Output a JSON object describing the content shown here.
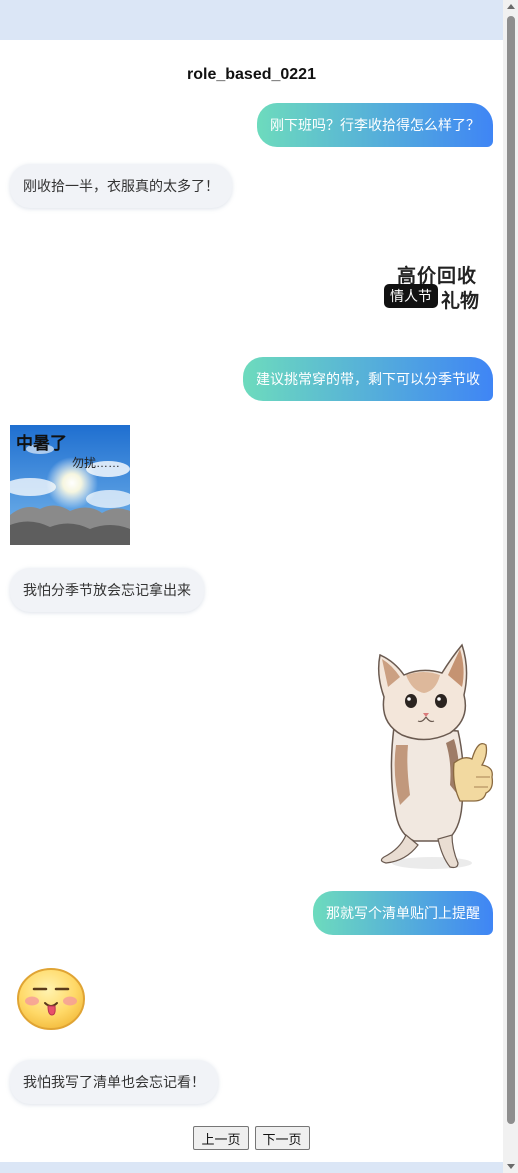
{
  "chat": {
    "title": "role_based_0221",
    "messages": [
      {
        "side": "right",
        "type": "text",
        "text": "刚下班吗？行李收拾得怎么样了？"
      },
      {
        "side": "left",
        "type": "text",
        "text": "刚收拾一半，衣服真的太多了！"
      },
      {
        "side": "right",
        "type": "sticker",
        "sticker": "text-sticker-gift-recycle",
        "lines": [
          "高价回收",
          "情人节",
          "礼物"
        ]
      },
      {
        "side": "right",
        "type": "text",
        "text": "建议挑常穿的带，剩下可以分季节收"
      },
      {
        "side": "left",
        "type": "sticker",
        "sticker": "heatstroke-sky-meme",
        "lines": [
          "中暑了",
          "勿扰……"
        ]
      },
      {
        "side": "left",
        "type": "text",
        "text": "我怕分季节放会忘记拿出来"
      },
      {
        "side": "right",
        "type": "sticker",
        "sticker": "kitten-thumbs-up"
      },
      {
        "side": "right",
        "type": "text",
        "text": "那就写个清单贴门上提醒"
      },
      {
        "side": "left",
        "type": "sticker",
        "sticker": "yellow-face-tongue-emoji"
      },
      {
        "side": "left",
        "type": "text",
        "text": "我怕我写了清单也会忘记看！"
      }
    ]
  },
  "pager": {
    "prev_label": "上一页",
    "next_label": "下一页"
  },
  "colors": {
    "bubble_gradient_start": "#6ddbbd",
    "bubble_gradient_end": "#3f85f5",
    "left_bubble": "#f1f3f7",
    "top_band": "#dbe6f6"
  }
}
